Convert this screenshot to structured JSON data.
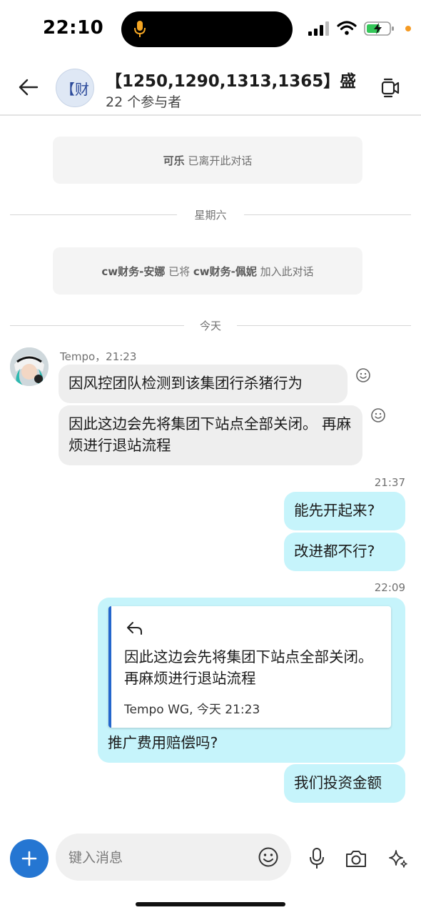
{
  "status_bar": {
    "time": "22:10"
  },
  "header": {
    "avatar_text": "【财",
    "title": "【1250,1290,1313,1365】盛世…",
    "subtitle": "22 个参与者"
  },
  "system_notices": [
    {
      "name": "可乐",
      "text": " 已离开此对话"
    },
    {
      "actor": "cw财务-安娜",
      "verb": " 已将 ",
      "target": "cw财务-佩妮",
      "tail": " 加入此对话"
    }
  ],
  "day_separators": [
    "星期六",
    "今天"
  ],
  "incoming": {
    "meta": "Tempo，21:23",
    "messages": [
      "因风控团队检测到该集团行杀猪行为",
      "因此这边会先将集团下站点全部关闭。 再麻烦进行退站流程"
    ]
  },
  "outgoing_1": {
    "timestamp": "21:37",
    "messages": [
      "能先开起来?",
      "改进都不行?"
    ]
  },
  "outgoing_2": {
    "timestamp": "22:09",
    "quote": {
      "text": "因此这边会先将集团下站点全部关闭。 再麻烦进行退站流程",
      "meta": "Tempo WG, 今天 21:23"
    },
    "reply": "推广费用赔偿吗?",
    "last": "我们投资金额"
  },
  "composer": {
    "placeholder": "键入消息"
  },
  "icons": {
    "back": "arrow-left-icon",
    "video": "video-call-icon",
    "add": "plus-icon",
    "emoji": "smiley-icon",
    "mic": "microphone-icon",
    "camera": "camera-icon",
    "ai": "sparkle-icon"
  }
}
